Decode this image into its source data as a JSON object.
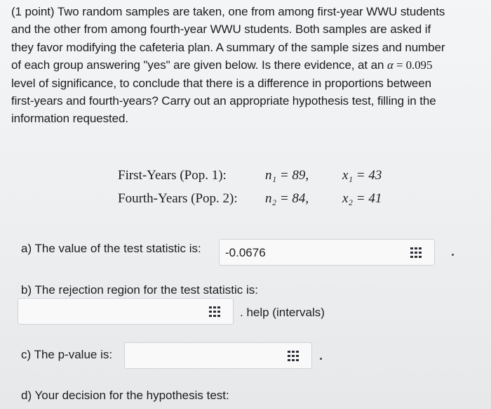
{
  "problem": {
    "line1": "(1 point) Two random samples are taken, one from among first-year WWU students",
    "line2": "and the other from among fourth-year WWU students. Both samples are asked if",
    "line3": "they favor modifying the cafeteria plan. A summary of the sample sizes and number",
    "line4a": "of each group answering \"yes\" are given below. Is there evidence, at an ",
    "alpha_sym": "α",
    "eq": " = ",
    "alpha_val": "0.095",
    "line5": "level of significance, to conclude that there is a difference in proportions between",
    "line6": "first-years and fourth-years? Carry out an appropriate hypothesis test, filling in the",
    "line7": "information requested."
  },
  "data_table": {
    "row1": {
      "label": "First-Years (Pop. 1):",
      "n": "n₁ = 89,",
      "x": "x₁ = 43"
    },
    "row2": {
      "label": "Fourth-Years (Pop. 2):",
      "n": "n₂ = 84,",
      "x": "x₂ = 41"
    }
  },
  "part_a": {
    "label": "a) The value of the test statistic is:",
    "value": "-0.0676"
  },
  "part_b": {
    "label": "b) The rejection region for the test statistic is:",
    "help": ". help (intervals)"
  },
  "part_c": {
    "label": "c) The p-value is:"
  },
  "part_d": {
    "label": "d) Your decision for the hypothesis test:"
  },
  "icons": {
    "matrix_icon": "grid-icon"
  }
}
